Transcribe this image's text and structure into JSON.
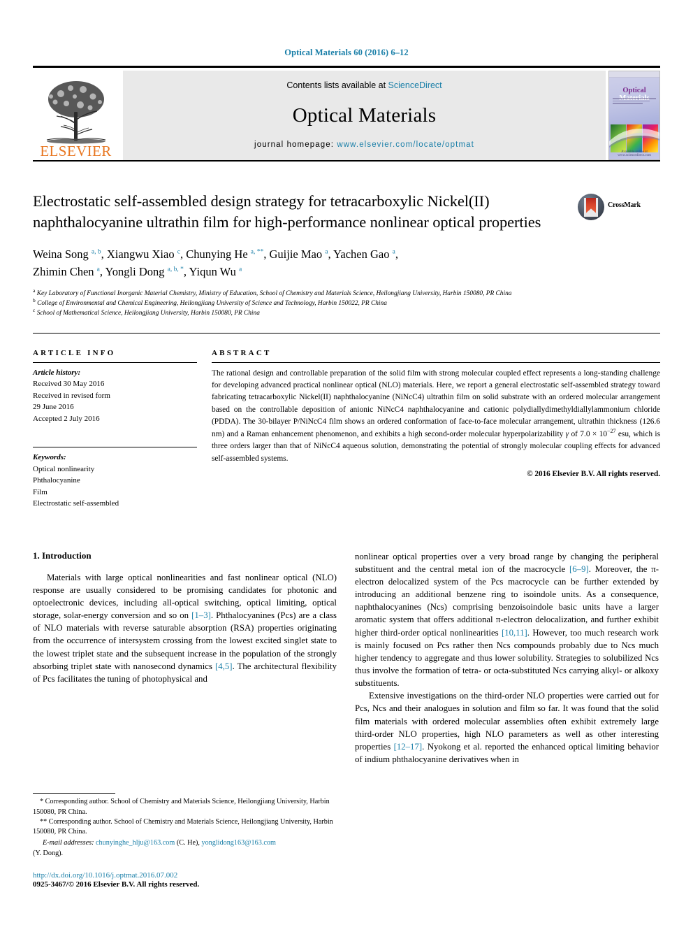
{
  "runningHead": "Optical Materials 60 (2016) 6–12",
  "masthead": {
    "contents_prefix": "Contents lists available at ",
    "contents_link": "ScienceDirect",
    "journal_name": "Optical Materials",
    "homepage_prefix": "journal homepage: ",
    "homepage_url": "www.elsevier.com/locate/optmat",
    "publisher": "ELSEVIER",
    "cover_title_a": "Optical",
    "cover_title_b": " Materials",
    "cover_footer": "Available online at www.sciencedirect.com"
  },
  "article": {
    "title": "Electrostatic self-assembled design strategy for tetracarboxylic Nickel(II) naphthalocyanine ultrathin film for high-performance nonlinear optical properties",
    "crossmark_label": "CrossMark",
    "authors_line1": [
      {
        "name": "Weina Song",
        "sup": "a, b",
        "sep": ", "
      },
      {
        "name": "Xiangwu Xiao",
        "sup": "c",
        "sep": ", "
      },
      {
        "name": "Chunying He",
        "sup": "a, **",
        "sep": ", "
      },
      {
        "name": "Guijie Mao",
        "sup": "a",
        "sep": ", "
      },
      {
        "name": "Yachen Gao",
        "sup": "a",
        "sep": ","
      }
    ],
    "authors_line2": [
      {
        "name": "Zhimin Chen",
        "sup": "a",
        "sep": ", "
      },
      {
        "name": "Yongli Dong",
        "sup": "a, b, *",
        "sep": ", "
      },
      {
        "name": "Yiqun Wu",
        "sup": "a",
        "sep": ""
      }
    ],
    "affiliations": [
      {
        "mark": "a",
        "text": "Key Laboratory of Functional Inorganic Material Chemistry, Ministry of Education, School of Chemistry and Materials Science, Heilongjiang University, Harbin 150080, PR China"
      },
      {
        "mark": "b",
        "text": "College of Environmental and Chemical Engineering, Heilongjiang University of Science and Technology, Harbin 150022, PR China"
      },
      {
        "mark": "c",
        "text": "School of Mathematical Science, Heilongjiang University, Harbin 150080, PR China"
      }
    ]
  },
  "info": {
    "heading": "ARTICLE INFO",
    "history_label": "Article history:",
    "history": [
      "Received 30 May 2016",
      "Received in revised form",
      "29 June 2016",
      "Accepted 2 July 2016"
    ],
    "keywords_label": "Keywords:",
    "keywords": [
      "Optical nonlinearity",
      "Phthalocyanine",
      "Film",
      "Electrostatic self-assembled"
    ]
  },
  "abstract": {
    "heading": "ABSTRACT",
    "text_part1": "The rational design and controllable preparation of the solid film with strong molecular coupled effect represents a long-standing challenge for developing advanced practical nonlinear optical (NLO) materials. Here, we report a general electrostatic self-assembled strategy toward fabricating tetracarboxylic Nickel(II) naphthalocyanine (NiNcC4) ultrathin film on solid substrate with an ordered molecular arrangement based on the controllable deposition of anionic NiNcC4 naphthalocyanine and cationic polydiallydimethyldiallylammonium chloride (PDDA). The 30-bilayer P/NiNcC4 film shows an ordered conformation of face-to-face molecular arrangement, ultrathin thickness (126.6 nm) and a Raman enhancement phenomenon, and exhibits a high second-order molecular hyperpolarizability ",
    "gamma": "γ",
    "text_part2": " of 7.0 × 10",
    "exponent": "−27",
    "text_part3": " esu, which is three orders larger than that of NiNcC4 aqueous solution, demonstrating the potential of strongly molecular coupling effects for advanced self-assembled systems.",
    "copyright": "© 2016 Elsevier B.V. All rights reserved."
  },
  "body": {
    "section_heading": "1. Introduction",
    "left_paragraph_a": "Materials with large optical nonlinearities and fast nonlinear optical (NLO) response are usually considered to be promising candidates for photonic and optoelectronic devices, including all-optical switching, optical limiting, optical storage, solar-energy conversion and so on ",
    "ref_1_3": "[1–3]",
    "left_paragraph_b": ". Phthalocyanines (Pcs) are a class of NLO materials with reverse saturable absorption (RSA) properties originating from the occurrence of intersystem crossing from the lowest excited singlet state to the lowest triplet state and the subsequent increase in the population of the strongly absorbing triplet state with nanosecond dynamics ",
    "ref_4_5": "[4,5]",
    "left_paragraph_c": ". The architectural flexibility of Pcs facilitates the tuning of photophysical and",
    "right_paragraph_a": "nonlinear optical properties over a very broad range by changing the peripheral substituent and the central metal ion of the macrocycle ",
    "ref_6_9": "[6–9]",
    "right_paragraph_b": ". Moreover, the π-electron delocalized system of the Pcs macrocycle can be further extended by introducing an additional benzene ring to isoindole units. As a consequence, naphthalocyanines (Ncs) comprising benzoisoindole basic units have a larger aromatic system that offers additional π-electron delocalization, and further exhibit higher third-order optical nonlinearities ",
    "ref_10_11": "[10,11]",
    "right_paragraph_c": ". However, too much research work is mainly focused on Pcs rather then Ncs compounds probably due to Ncs much higher tendency to aggregate and thus lower solubility. Strategies to solubilized Ncs thus involve the formation of tetra- or octa-substituted Ncs carrying alkyl- or alkoxy substituents.",
    "right_paragraph_d": "Extensive investigations on the third-order NLO properties were carried out for Pcs, Ncs and their analogues in solution and film so far. It was found that the solid film materials with ordered molecular assemblies often exhibit extremely large third-order NLO properties, high NLO parameters as well as other interesting properties ",
    "ref_12_17": "[12–17]",
    "right_paragraph_e": ". Nyokong et al. reported the enhanced optical limiting behavior of indium phthalocyanine derivatives when in"
  },
  "footnotes": {
    "corr1_mark": "*",
    "corr1": " Corresponding author. School of Chemistry and Materials Science, Heilongjiang University, Harbin 150080, PR China.",
    "corr2_mark": "**",
    "corr2": " Corresponding author. School of Chemistry and Materials Science, Heilongjiang University, Harbin 150080, PR China.",
    "email_label": "E-mail addresses:",
    "email1": "chunyinghe_hlju@163.com",
    "email1_owner": " (C. He), ",
    "email2": "yonglidong163@163.com",
    "email2_owner": "(Y. Dong).",
    "doi": "http://dx.doi.org/10.1016/j.optmat.2016.07.002",
    "issn": "0925-3467/© 2016 Elsevier B.V. All rights reserved."
  },
  "colors": {
    "link": "#1a7fa8",
    "elsevier_orange": "#E87722",
    "band_gray": "#e9e9e9"
  }
}
